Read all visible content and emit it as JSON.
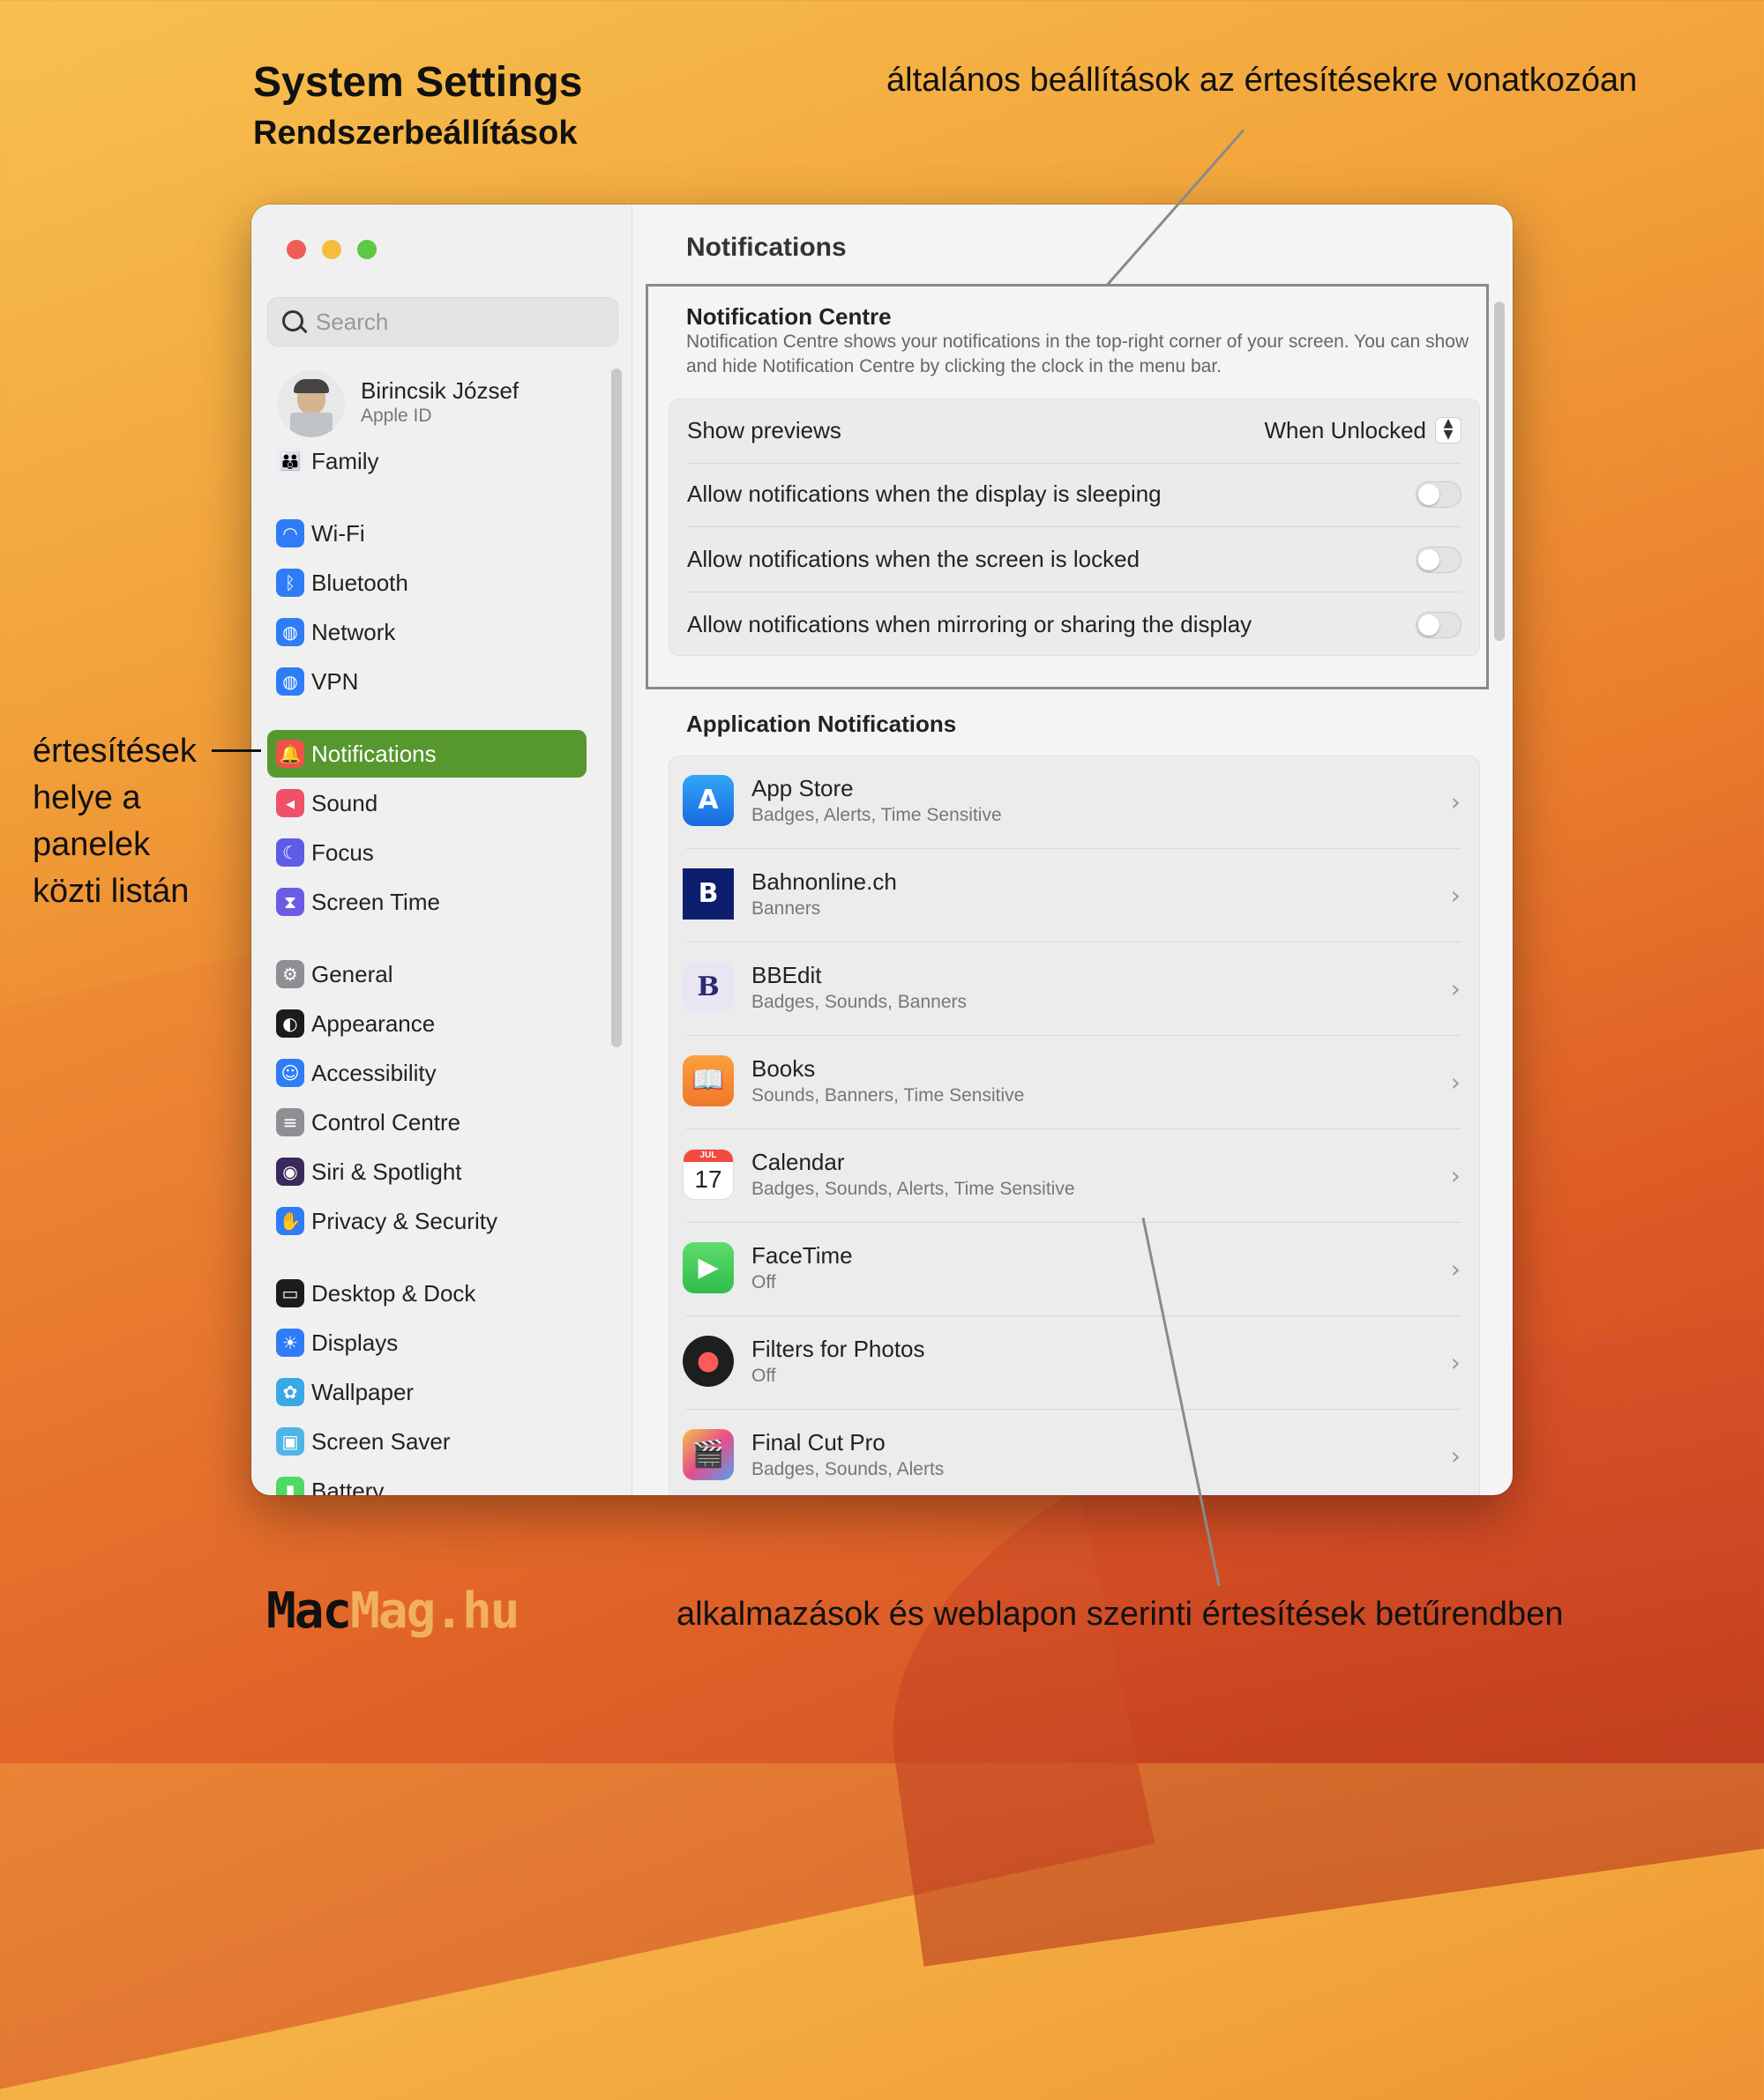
{
  "annotations": {
    "title_en": "System Settings",
    "title_hu": "Rendszerbeállítások",
    "top": "általános beállítások az értesítésekre vonatkozóan",
    "left": "értesítések helye a panelek közti listán",
    "bottom": "alkalmazások és weblapon szerinti értesítések betűrendben",
    "logo_part1": "Mac",
    "logo_part2": "Mag.hu"
  },
  "sidebar": {
    "search_placeholder": "Search",
    "user": {
      "name": "Birincsik József",
      "sub": "Apple ID"
    },
    "items": [
      {
        "label": "Family",
        "icon": "family-icon",
        "color": "#e9eef7"
      },
      {
        "label": "Wi-Fi",
        "icon": "wifi-icon",
        "color": "#2f7cf6"
      },
      {
        "label": "Bluetooth",
        "icon": "bluetooth-icon",
        "color": "#2f7cf6"
      },
      {
        "label": "Network",
        "icon": "network-icon",
        "color": "#2f7cf6"
      },
      {
        "label": "VPN",
        "icon": "vpn-icon",
        "color": "#2f7cf6"
      },
      {
        "label": "Notifications",
        "icon": "bell-icon",
        "color": "#f0504a",
        "active": true
      },
      {
        "label": "Sound",
        "icon": "sound-icon",
        "color": "#f0506a"
      },
      {
        "label": "Focus",
        "icon": "moon-icon",
        "color": "#5e5ce6"
      },
      {
        "label": "Screen Time",
        "icon": "hourglass-icon",
        "color": "#6b5ce6"
      },
      {
        "label": "General",
        "icon": "gear-icon",
        "color": "#8e8e93"
      },
      {
        "label": "Appearance",
        "icon": "appearance-icon",
        "color": "#1c1c1e"
      },
      {
        "label": "Accessibility",
        "icon": "accessibility-icon",
        "color": "#2f7cf6"
      },
      {
        "label": "Control Centre",
        "icon": "control-centre-icon",
        "color": "#8e8e93"
      },
      {
        "label": "Siri & Spotlight",
        "icon": "siri-icon",
        "color": "#3a2a5c"
      },
      {
        "label": "Privacy & Security",
        "icon": "hand-icon",
        "color": "#2f7cf6"
      },
      {
        "label": "Desktop & Dock",
        "icon": "dock-icon",
        "color": "#1c1c1e"
      },
      {
        "label": "Displays",
        "icon": "sun-icon",
        "color": "#2f7cf6"
      },
      {
        "label": "Wallpaper",
        "icon": "flower-icon",
        "color": "#3aa8e6"
      },
      {
        "label": "Screen Saver",
        "icon": "screensaver-icon",
        "color": "#4fb4e6"
      },
      {
        "label": "Battery",
        "icon": "battery-icon",
        "color": "#4cd964"
      }
    ]
  },
  "main": {
    "title": "Notifications",
    "nc_title": "Notification Centre",
    "nc_desc": "Notification Centre shows your notifications in the top-right corner of your screen. You can show and hide Notification Centre by clicking the clock in the menu bar.",
    "show_previews_label": "Show previews",
    "show_previews_value": "When Unlocked",
    "toggles": [
      {
        "label": "Allow notifications when the display is sleeping",
        "on": false
      },
      {
        "label": "Allow notifications when the screen is locked",
        "on": false
      },
      {
        "label": "Allow notifications when mirroring or sharing the display",
        "on": false
      }
    ],
    "app_title": "Application Notifications",
    "apps": [
      {
        "name": "App Store",
        "sub": "Badges, Alerts, Time Sensitive",
        "icon": "app-store-icon"
      },
      {
        "name": "Bahnonline.ch",
        "sub": "Banners",
        "icon": "bahnonline-icon"
      },
      {
        "name": "BBEdit",
        "sub": "Badges, Sounds, Banners",
        "icon": "bbedit-icon"
      },
      {
        "name": "Books",
        "sub": "Sounds, Banners, Time Sensitive",
        "icon": "books-icon"
      },
      {
        "name": "Calendar",
        "sub": "Badges, Sounds, Alerts, Time Sensitive",
        "icon": "calendar-icon",
        "cal_month": "JUL",
        "cal_day": "17"
      },
      {
        "name": "FaceTime",
        "sub": "Off",
        "icon": "facetime-icon"
      },
      {
        "name": "Filters for Photos",
        "sub": "Off",
        "icon": "filters-icon"
      },
      {
        "name": "Final Cut Pro",
        "sub": "Badges, Sounds, Alerts",
        "icon": "final-cut-icon"
      }
    ]
  }
}
